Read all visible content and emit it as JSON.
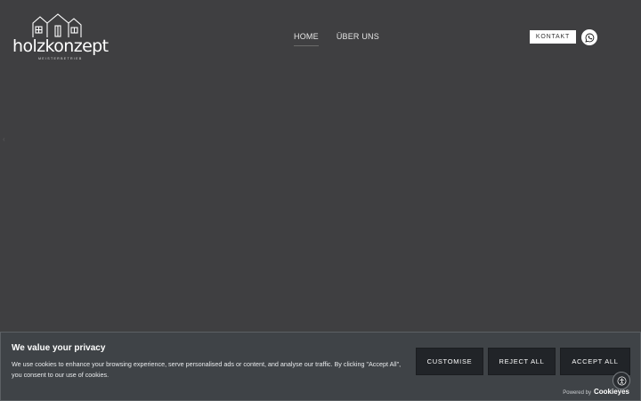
{
  "logo": {
    "wordmark": "holzkonzept",
    "tagline": "MEISTERBETRIEB"
  },
  "nav": {
    "items": [
      "HOME",
      "ÜBER UNS"
    ]
  },
  "header": {
    "contact_label": "KONTAKT",
    "whatsapp_icon": "whatsapp-icon"
  },
  "cookie_banner": {
    "title": "We value your privacy",
    "text": "We use cookies to enhance your browsing experience, serve personalised ads or content, and analyse our traffic. By clicking \"Accept All\", you consent to our use of cookies.",
    "customise_label": "CUSTOMISE",
    "reject_label": "REJECT ALL",
    "accept_label": "ACCEPT ALL",
    "powered_by": "Powered by",
    "brand": "Cookieyes"
  },
  "accessibility": {
    "icon": "accessibility-icon"
  },
  "colors": {
    "background": "#3f3f41",
    "banner": "#3f4347",
    "button": "#212428",
    "contact_bg": "#ffffff"
  }
}
